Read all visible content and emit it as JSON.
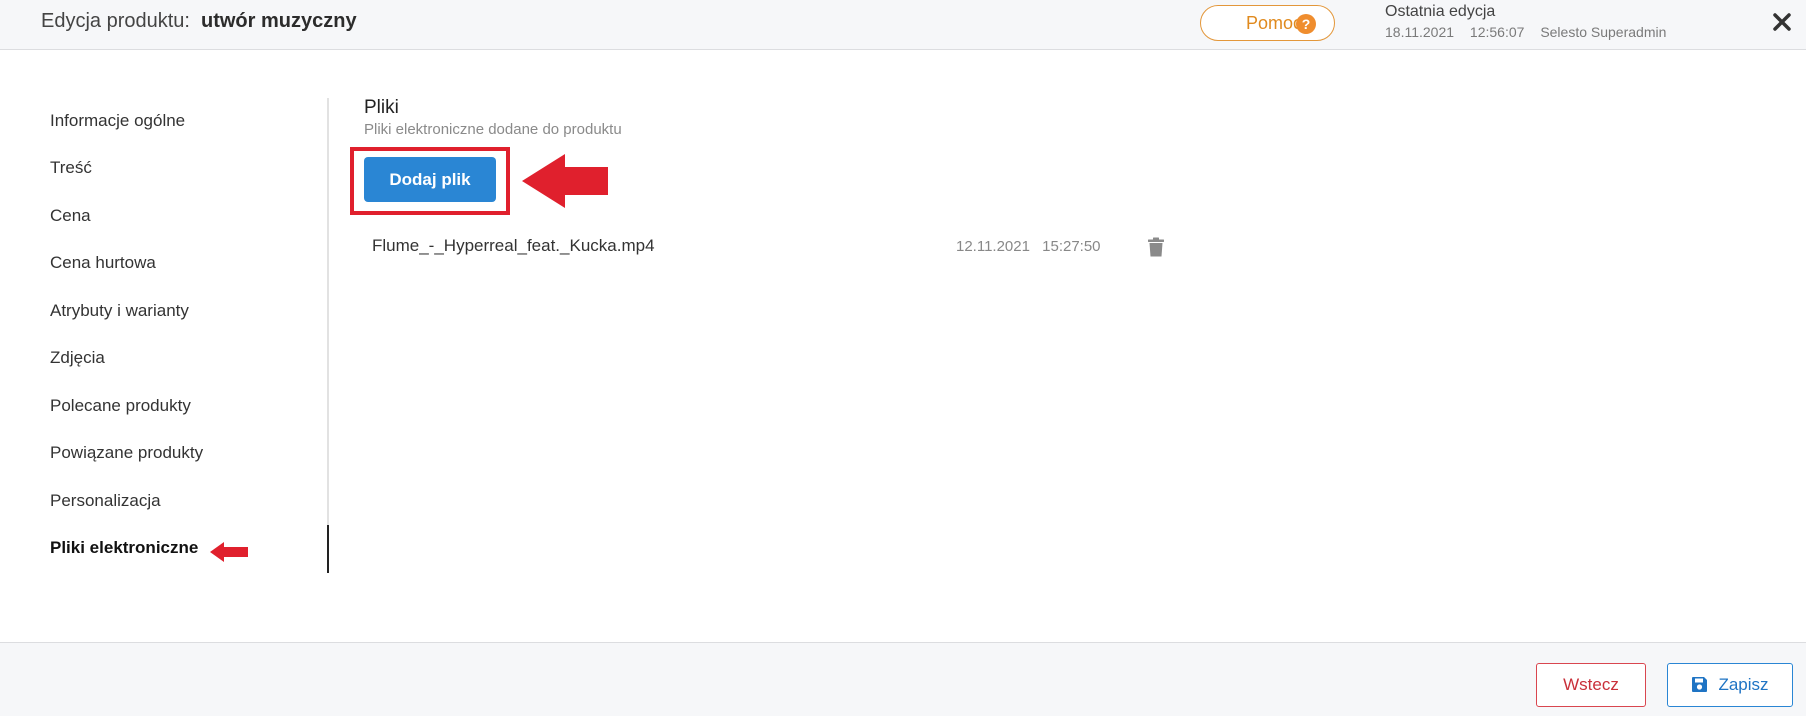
{
  "header": {
    "title_label": "Edycja produktu:",
    "title_name": "utwór muzyczny",
    "help_label": "Pomoc",
    "help_icon_glyph": "?",
    "last_edit_label": "Ostatnia edycja",
    "last_edit_date": "18.11.2021",
    "last_edit_time": "12:56:07",
    "last_edit_user": "Selesto Superadmin",
    "close_icon": "close-icon"
  },
  "sidebar": {
    "items": [
      {
        "label": "Informacje ogólne"
      },
      {
        "label": "Treść"
      },
      {
        "label": "Cena"
      },
      {
        "label": "Cena hurtowa"
      },
      {
        "label": "Atrybuty i warianty"
      },
      {
        "label": "Zdjęcia"
      },
      {
        "label": "Polecane produkty"
      },
      {
        "label": "Powiązane produkty"
      },
      {
        "label": "Personalizacja"
      },
      {
        "label": "Pliki elektroniczne",
        "active": true
      }
    ]
  },
  "main": {
    "section_title": "Pliki",
    "section_subtitle": "Pliki elektroniczne dodane do produktu",
    "add_file_label": "Dodaj plik",
    "files": [
      {
        "name": "Flume_-_Hyperreal_feat._Kucka.mp4",
        "date": "12.11.2021",
        "time": "15:27:50",
        "delete_icon": "trash-icon"
      }
    ]
  },
  "footer": {
    "back_label": "Wstecz",
    "save_label": "Zapisz",
    "save_icon": "floppy-disk-icon"
  },
  "colors": {
    "primary": "#2a86d4",
    "help_accent": "#e3973a",
    "danger": "#d9464f",
    "annotation_red": "#e0202d"
  }
}
